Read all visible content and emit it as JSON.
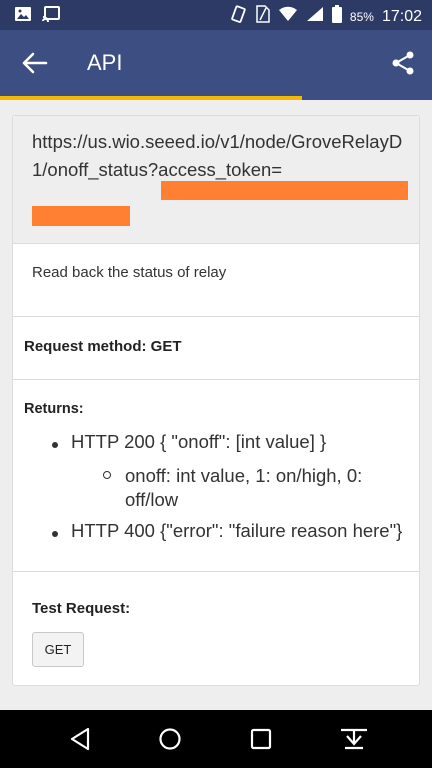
{
  "status_bar": {
    "battery_percent": "85%",
    "time": "17:02",
    "icons": [
      "image-icon",
      "cast-icon",
      "vibrate-icon",
      "sim-icon",
      "wifi-icon",
      "signal-icon",
      "battery-icon"
    ]
  },
  "app_bar": {
    "title": "API",
    "back_icon": "arrow-back-icon",
    "share_icon": "share-icon",
    "progress_fraction": 0.7
  },
  "api": {
    "url": "https://us.wio.seeed.io/v1/node/GroveRelayD1/onoff_status?access_token=",
    "description": "Read back the status of relay",
    "method_label": "Request method: GET",
    "returns_label": "Returns:",
    "returns": [
      {
        "text": "HTTP 200 { \"onoff\": [int value] }",
        "sub": [
          "onoff: int value, 1: on/high, 0: off/low"
        ]
      },
      {
        "text": "HTTP 400 {\"error\": \"failure reason here\"}",
        "sub": []
      }
    ],
    "test_label": "Test Request:",
    "test_button": "GET",
    "redaction_color": "#ff8033"
  },
  "colors": {
    "statusbar": "#2d3a66",
    "appbar": "#3c4e82",
    "accent": "#f5b800"
  },
  "nav_bar": {
    "icons": [
      "back-triangle-icon",
      "home-circle-icon",
      "recents-square-icon",
      "download-icon"
    ]
  }
}
